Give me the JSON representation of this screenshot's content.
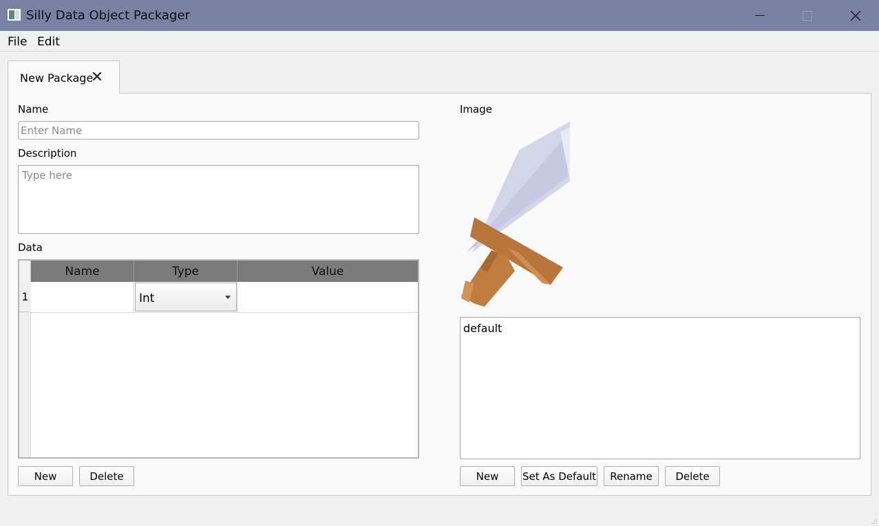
{
  "window": {
    "title": "Silly Data Object Packager"
  },
  "menu": {
    "file": "File",
    "edit": "Edit"
  },
  "tab": {
    "label": "New Package"
  },
  "form": {
    "name_label": "Name",
    "name_placeholder": "Enter Name",
    "name_value": "",
    "description_label": "Description",
    "description_placeholder": "Type here",
    "description_value": "",
    "data_label": "Data",
    "image_label": "Image"
  },
  "data_table": {
    "columns": [
      "Name",
      "Type",
      "Value"
    ],
    "rows": [
      {
        "number": "1",
        "name": "",
        "type": "Int",
        "value": ""
      }
    ]
  },
  "data_buttons": {
    "new": "New",
    "delete": "Delete"
  },
  "image": {
    "preview_icon": "sword-icon",
    "variants": [
      "default"
    ]
  },
  "image_buttons": {
    "new": "New",
    "set_default": "Set As Default",
    "rename": "Rename",
    "delete": "Delete"
  },
  "colors": {
    "titlebar": "#7a82a4",
    "header": "#7b7b7b",
    "blade": "#d3d6ea",
    "hilt": "#b8763c"
  }
}
